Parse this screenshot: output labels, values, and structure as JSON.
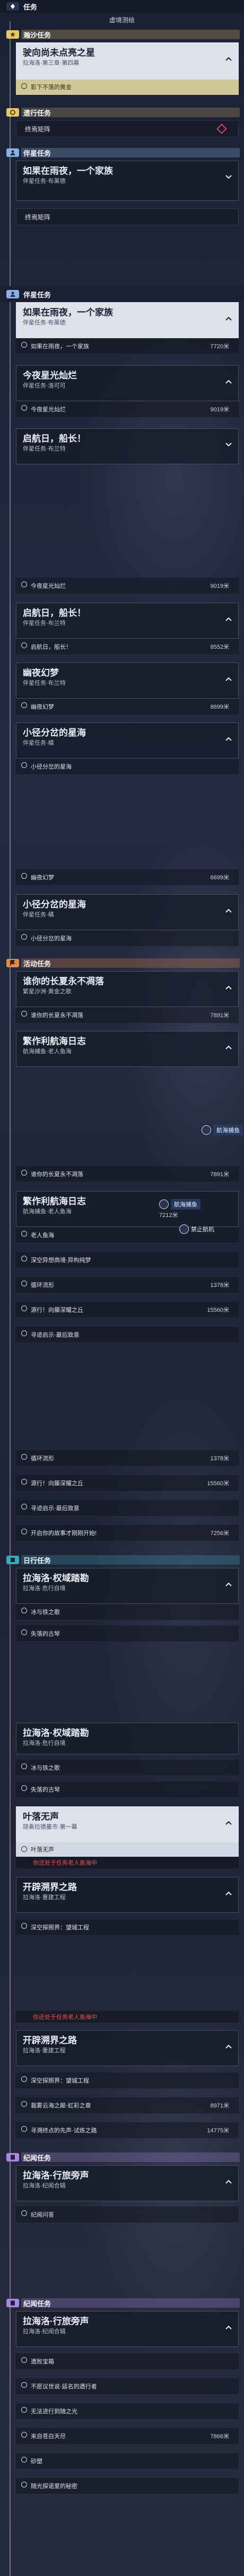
{
  "sec1": {
    "header": "任务",
    "subtitle": "虚境测绘",
    "rare_header": "瀚沙任务",
    "q1_title": "驶向尚未点亮之星",
    "q1_sub": "拉海洛·第三章·第四幕",
    "q1_step": "影下不落的黄金",
    "story_header": "遗行任务",
    "story_row": "终焉矩阵",
    "companion_header": "伴星任务",
    "q2_title": "如果在雨夜，一个家族",
    "q2_sub": "伴星任务·布莱德",
    "q2_row": "终焉矩阵"
  },
  "sec2": {
    "companion_header": "伴星任务",
    "q2_title": "如果在雨夜，一个家族",
    "q2_sub": "伴星任务·布莱德",
    "q2_step": "如果在雨夜，一个家族",
    "q2_dist": "7720米",
    "q3_title": "今夜星光灿烂",
    "q3_sub": "伴星任务·洛可可",
    "q3_step": "今夜星光灿烂",
    "q3_dist": "9019米",
    "q4_title": "启航日，船长！",
    "q4_sub": "伴星任务·布兰特"
  },
  "sec3": {
    "r0": "今夜星光灿烂",
    "r0d": "9019米",
    "q4_title": "启航日，船长！",
    "q4_sub": "伴星任务·布兰特",
    "q4_step": "启航日，船长！",
    "q4_dist": "8552米",
    "q5_title": "幽夜幻梦",
    "q5_sub": "伴星任务·布兰特",
    "q5_step": "幽夜幻梦",
    "q5_dist": "8699米",
    "q6_title": "小径分岔的星海",
    "q6_sub": "伴星任务·橘",
    "q6_step": "小径分岔的星海"
  },
  "sec4": {
    "r0": "幽夜幻梦",
    "r0d": "6699米",
    "q6_title": "小径分岔的星海",
    "q6_sub": "伴星任务·橘",
    "q6_step": "小径分岔的星海",
    "event_header": "活动任务",
    "q7_title": "谁你的长夏永不凋落",
    "q7_sub": "繁星沙洲·黄金之歌",
    "q7_step": "谁你的长夏永不凋落",
    "q7_dist": "7891米",
    "q8_title": "繁作利航海日志",
    "q8_sub": "航海捕鱼·老人鱼海",
    "popup": "航海捕鱼"
  },
  "sec5": {
    "r0": "谁你的长夏永不凋落",
    "r0d": "7891米",
    "q8_title": "繁作利航海日志",
    "q8_sub": "航海捕鱼·老人鱼海",
    "popup": "航海捕鱼",
    "popup_dist": "7212米",
    "popup2": "禁止航机",
    "r1": "老人鱼海",
    "r2": "深空异想商境·异构纯梦",
    "r3": "循环流形",
    "r3d": "1378米",
    "r4": "源行！向藤深耀之丘",
    "r4d": "15560米",
    "r5": "寻迹启示·最后致意"
  },
  "sec6": {
    "r1": "循环流形",
    "r1d": "1378米",
    "r2": "源行！向藤深耀之丘",
    "r2d": "15560米",
    "r3": "寻迹启示·最后致意",
    "r4": "开启你的故事才刚刚开始!",
    "r4d": "7256米",
    "daily_header": "日行任务",
    "q9_title": "拉海洛·权域踏勘",
    "q9_sub": "拉海洛·危行自境",
    "r5": "冰与铁之歌",
    "r6": "失落的古琴"
  },
  "sec7": {
    "q9_title": "拉海洛·权域踏勘",
    "q9_sub": "拉海洛·危行自境",
    "r1": "冰与铁之歌",
    "r2": "失落的古琴",
    "q10_title": "叶落无声",
    "q10_sub": "琼奏拉德曼市·第一幕",
    "r3": "叶落无声",
    "warn1": "你还处于任务老人鱼海中",
    "q11_title": "开辟溯界之路",
    "q11_sub": "拉海洛·重建工程",
    "r4": "深空探照界：望城工程"
  },
  "sec8": {
    "warn": "你还处于任务老人鱼海中",
    "q11_title": "开辟溯界之路",
    "q11_sub": "拉海洛·重建工程",
    "r1": "深空探照界：望城工程",
    "r2": "裁雾云海之颠·虹彩之章",
    "r2d": "8971米",
    "r3": "寻溯终点的先声·试炼之路",
    "r3d": "14775米",
    "quest_header": "纪闻任务",
    "q12_title": "拉海洛·行旅旁声",
    "q12_sub": "拉海洛·纪闻合辑",
    "r4": "纪闻问答"
  },
  "sec9": {
    "quest_header": "纪闻任务",
    "q12_title": "拉海洛·行旅旁声",
    "q12_sub": "拉海洛·纪闻合辑",
    "r1": "遗败宝箱",
    "r2": "不愿议世说·延名的遗行者",
    "r3": "无法进行到随之光",
    "r4": "来自苍白天尽",
    "r4d": "7866米",
    "r5": "砂塑",
    "r6": "随光探诺爱的秘密"
  },
  "colors": {
    "accent_blue": "#8ab0e6",
    "accent_purple": "#a888e0",
    "accent_orange": "#e08a4a",
    "accent_teal": "#3aa8b8",
    "accent_pink": "#e06a88",
    "rare": "#e8c66a",
    "dark_header": "#141a28"
  }
}
